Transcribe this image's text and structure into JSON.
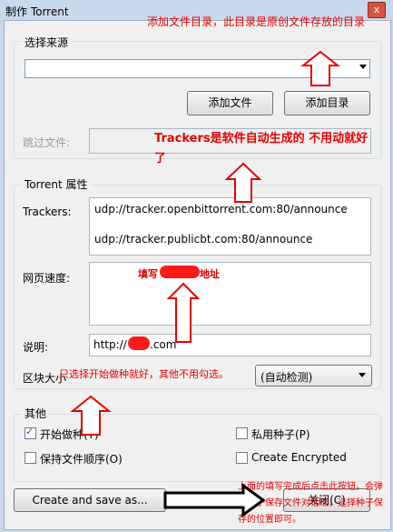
{
  "window": {
    "title": "制作 Torrent",
    "close": "x"
  },
  "source": {
    "group_label": "选择来源",
    "combo_value": "",
    "add_file": "添加文件",
    "add_dir": "添加目录",
    "skip_label": "跳过文件:"
  },
  "props": {
    "group_label": "Torrent 属性",
    "trackers_label": "Trackers:",
    "trackers": [
      "udp://tracker.openbittorrent.com:80/announce",
      "udp://tracker.publicbt.com:80/announce"
    ],
    "web_seed_label": "网页速度:",
    "comment_label": "说明:",
    "comment_prefix": "http://",
    "comment_suffix": ".com",
    "piece_label": "区块大小",
    "piece_value": "(自动检测)"
  },
  "other": {
    "group_label": "其他",
    "start_seeding": "开始做种(T)",
    "private": "私用种子(P)",
    "preserve_order": "保持文件顺序(O)",
    "encrypted": "Create Encrypted"
  },
  "buttons": {
    "create": "Create and save as...",
    "close": "关闭(C)"
  },
  "annotations": {
    "a1": "添加文件目录，此目录是原创文件存放的目录",
    "a2": "Trackers是软件自动生成的 不用动就好了",
    "a3": "填写",
    "a3b": "地址",
    "a4": "只选择开始做种就好，其他不用勾选。",
    "a5": "上面的填写完成后点击此按钮，会弹出种子保存文件对话框，选择种子保存的位置即可。"
  },
  "colors": {
    "annotation": "#e60000",
    "redact": "#ff1a1a"
  }
}
